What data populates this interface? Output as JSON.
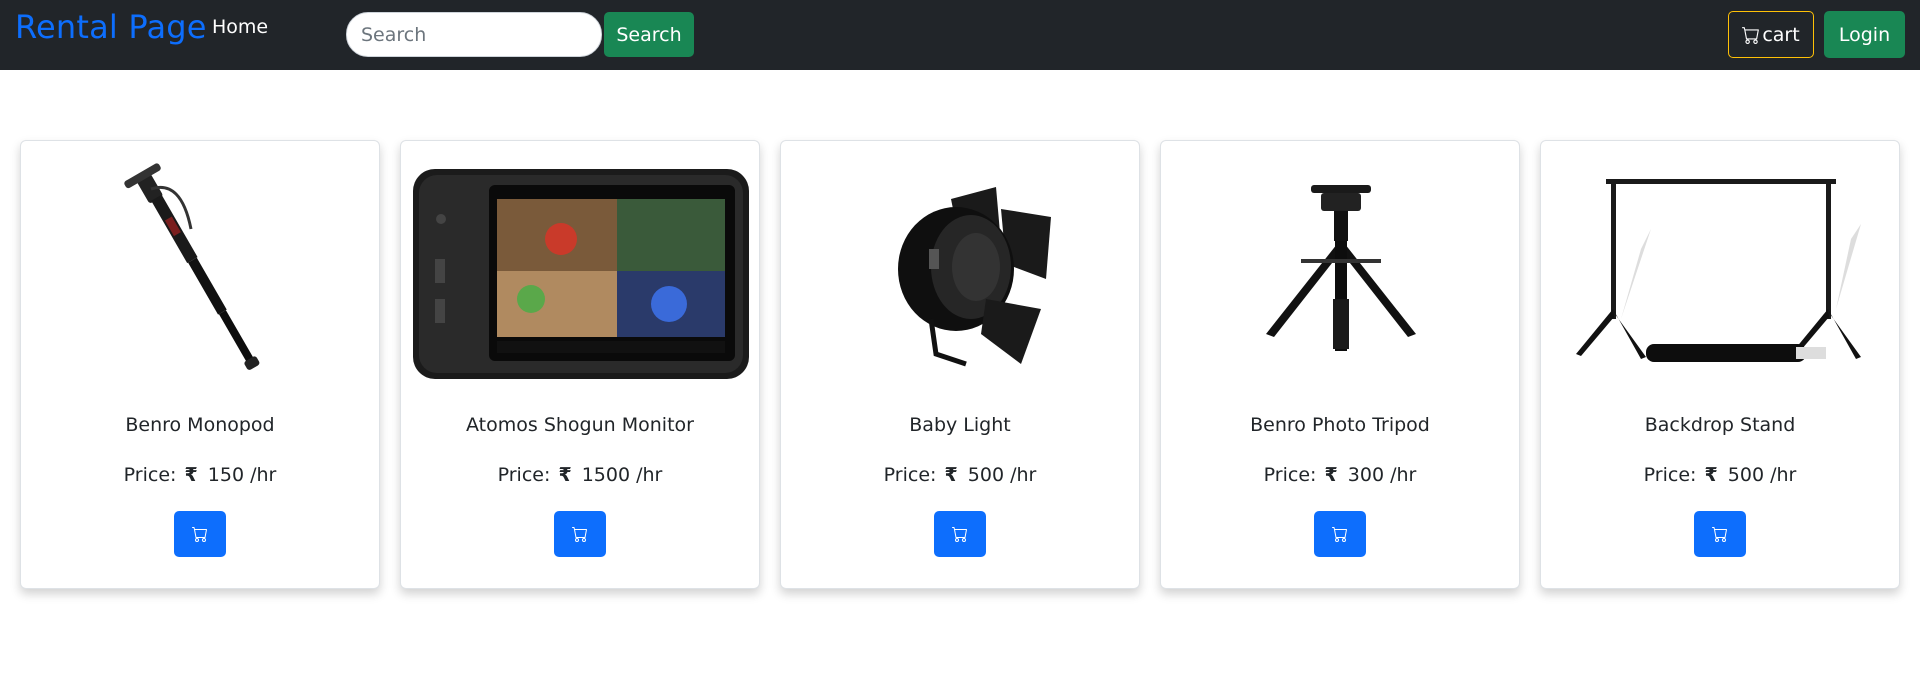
{
  "navbar": {
    "brand": "Rental Page",
    "home_link": "Home",
    "search_placeholder": "Search",
    "search_button": "Search",
    "cart_button": "cart",
    "login_button": "Login"
  },
  "colors": {
    "navbar_bg": "#212529",
    "brand": "#0d6efd",
    "success": "#198754",
    "primary": "#0d6efd",
    "cart_border": "#ffc107"
  },
  "products": [
    {
      "name": "Benro Monopod",
      "price_label": "Price:",
      "currency_icon": "rupee-icon",
      "price": "150 /hr",
      "image_icon": "monopod-image"
    },
    {
      "name": "Atomos Shogun Monitor",
      "price_label": "Price:",
      "currency_icon": "rupee-icon",
      "price": "1500 /hr",
      "image_icon": "monitor-image"
    },
    {
      "name": "Baby Light",
      "price_label": "Price:",
      "currency_icon": "rupee-icon",
      "price": "500 /hr",
      "image_icon": "studio-light-image"
    },
    {
      "name": "Benro Photo Tripod",
      "price_label": "Price:",
      "currency_icon": "rupee-icon",
      "price": "300 /hr",
      "image_icon": "tripod-image"
    },
    {
      "name": "Backdrop Stand",
      "price_label": "Price:",
      "currency_icon": "rupee-icon",
      "price": "500 /hr",
      "image_icon": "backdrop-stand-image"
    }
  ]
}
